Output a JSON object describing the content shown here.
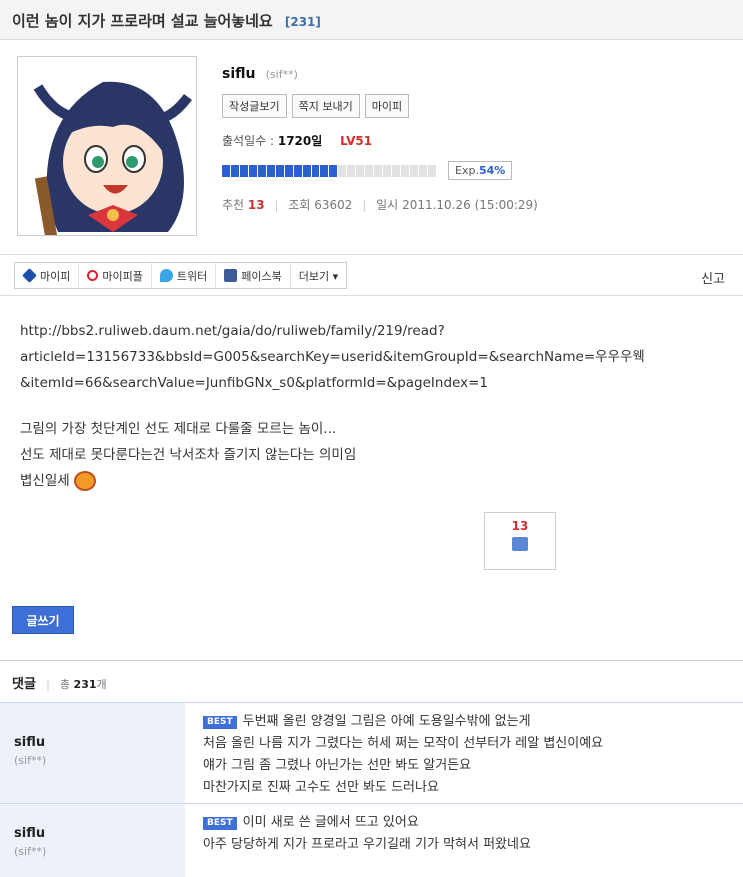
{
  "post": {
    "title": "이런 놈이 지가 프로라며 설교 늘어놓네요",
    "comment_count": "[231]"
  },
  "author": {
    "nickname": "siflu",
    "id_masked": "(sif**)",
    "buttons": [
      "작성글보기",
      "쪽지 보내기",
      "마이피"
    ],
    "attend_label": "출석일수 :",
    "attend_days": "1720일",
    "level": "LV51",
    "exp_label": "Exp.",
    "exp_percent": "54%",
    "exp_fraction": 0.54
  },
  "stats": {
    "recommend_label": "추천",
    "recommend": "13",
    "views_label": "조회",
    "views": "63602",
    "date_label": "일시",
    "date": "2011.10.26 (15:00:29)"
  },
  "share": {
    "items": [
      "마이피",
      "마이피플",
      "트위터",
      "페이스북",
      "더보기 ▾"
    ],
    "icons": [
      "cube-icon",
      "glasses-icon",
      "bird-icon",
      "facebook-icon"
    ],
    "report": "신고"
  },
  "content": {
    "url_lines": [
      "http://bbs2.ruliweb.daum.net/gaia/do/ruliweb/family/219/read?",
      "articleId=13156733&bbsId=G005&searchKey=userid&itemGroupId=&searchName=우우우웩",
      "&itemId=66&searchValue=JunfibGNx_s0&platformId=&pageIndex=1"
    ],
    "text_lines": [
      "그림의 가장 첫단계인 선도 제대로 다룰줄 모르는 놈이...",
      "선도 제대로 못다룬다는건 낙서조차 즐기지 않는다는 의미임",
      "볍신일세"
    ],
    "like_count": "13"
  },
  "write_button": "글쓰기",
  "comments_header": {
    "label": "댓글",
    "total_prefix": "총",
    "total": "231",
    "total_suffix": "개"
  },
  "comments": [
    {
      "author": "siflu",
      "id_masked": "(sif**)",
      "badge": "BEST",
      "lines": [
        "두번째 올린 양경일 그림은 아예 도용일수밖에 없는게",
        "처음 올린 나름 지가 그렸다는 허세 쩌는 모작이 선부터가 레알 볍신이예요",
        "얘가 그림 좀 그렸나 아닌가는 선만 봐도 알거든요",
        "마찬가지로 진짜 고수도 선만 봐도 드러나요"
      ]
    },
    {
      "author": "siflu",
      "id_masked": "(sif**)",
      "badge": "BEST",
      "lines": [
        "이미 새로 쓴 글에서 뜨고 있어요",
        "아주 당당하게 지가 프로라고 우기길래 기가 막혀서 퍼왔네요"
      ]
    }
  ]
}
